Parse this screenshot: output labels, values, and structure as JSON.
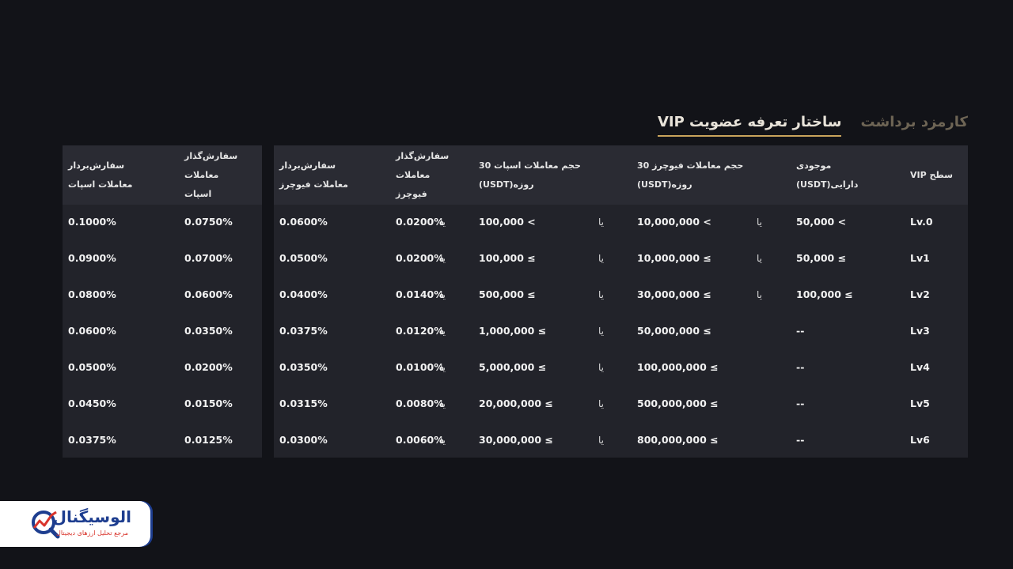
{
  "tabs": [
    {
      "label": "ساختار تعرفه عضویت VIP",
      "active": true
    },
    {
      "label": "کارمزد برداشت",
      "active": false
    }
  ],
  "table": {
    "headers": {
      "level": [
        "سطح VIP"
      ],
      "assets": [
        "موجودی",
        "دارایی(USDT)"
      ],
      "futures_volume": [
        "حجم معاملات فیوچرز 30",
        "روزه(USDT)"
      ],
      "spot_volume": [
        "حجم معاملات اسپات 30",
        "روزه(USDT)"
      ],
      "futures_maker": [
        "سفارش‌گذار",
        "معاملات",
        "فیوچرز"
      ],
      "futures_taker": [
        "سفارش‌بردار",
        "معاملات فیوچرز"
      ],
      "spot_maker": [
        "سفارش‌گذار",
        "معاملات",
        "اسپات"
      ],
      "spot_taker": [
        "سفارش‌بردار",
        "معاملات اسپات"
      ]
    },
    "or_label": "یا",
    "rows": [
      {
        "level": "Lv.0",
        "assets": "50,000 <",
        "assets_or": "یا",
        "futures_volume": "10,000,000 <",
        "futures_or": "یا",
        "spot_volume": "100,000 <",
        "futures_maker": "0.0200%",
        "futures_taker": "0.0600%",
        "spot_maker": "0.0750%",
        "spot_taker": "0.1000%"
      },
      {
        "level": "Lv1",
        "assets": "50,000 ≤",
        "assets_or": "یا",
        "futures_volume": "10,000,000 ≤",
        "futures_or": "یا",
        "spot_volume": "100,000 ≤",
        "futures_maker": "0.0200%",
        "futures_taker": "0.0500%",
        "spot_maker": "0.0700%",
        "spot_taker": "0.0900%"
      },
      {
        "level": "Lv2",
        "assets": "100,000 ≤",
        "assets_or": "یا",
        "futures_volume": "30,000,000 ≤",
        "futures_or": "یا",
        "spot_volume": "500,000 ≤",
        "futures_maker": "0.0140%",
        "futures_taker": "0.0400%",
        "spot_maker": "0.0600%",
        "spot_taker": "0.0800%"
      },
      {
        "level": "Lv3",
        "assets": "--",
        "assets_or": "",
        "futures_volume": "50,000,000 ≤",
        "futures_or": "یا",
        "spot_volume": "1,000,000 ≤",
        "futures_maker": "0.0120%",
        "futures_taker": "0.0375%",
        "spot_maker": "0.0350%",
        "spot_taker": "0.0600%"
      },
      {
        "level": "Lv4",
        "assets": "--",
        "assets_or": "",
        "futures_volume": "100,000,000 ≤",
        "futures_or": "یا",
        "spot_volume": "5,000,000 ≤",
        "futures_maker": "0.0100%",
        "futures_taker": "0.0350%",
        "spot_maker": "0.0200%",
        "spot_taker": "0.0500%"
      },
      {
        "level": "Lv5",
        "assets": "--",
        "assets_or": "",
        "futures_volume": "500,000,000 ≤",
        "futures_or": "یا",
        "spot_volume": "20,000,000 ≤",
        "futures_maker": "0.0080%",
        "futures_taker": "0.0315%",
        "spot_maker": "0.0150%",
        "spot_taker": "0.0450%"
      },
      {
        "level": "Lv6",
        "assets": "--",
        "assets_or": "",
        "futures_volume": "800,000,000 ≤",
        "futures_or": "یا",
        "spot_volume": "30,000,000 ≤",
        "futures_maker": "0.0060%",
        "futures_taker": "0.0300%",
        "spot_maker": "0.0125%",
        "spot_taker": "0.0375%"
      }
    ]
  },
  "logo": {
    "title": "الوسیگنال",
    "subtitle": "مرجع تحلیل ارزهای دیجیتال",
    "icon": "magnifier-chart-icon",
    "colors": {
      "primary": "#1d3d8f",
      "accent": "#d9342b"
    }
  },
  "colors": {
    "background": "#121318",
    "table": "#22232a",
    "header": "#2a2b33",
    "tab_active_underline": "#c9a45c",
    "tab_inactive": "#6e6555"
  }
}
